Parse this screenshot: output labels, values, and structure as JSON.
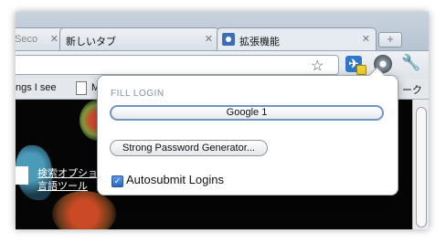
{
  "tabs": [
    {
      "label": "Seco",
      "close": "✕"
    },
    {
      "label": "新しいタブ",
      "close": "✕"
    },
    {
      "label": "拡張機能",
      "close": "✕"
    }
  ],
  "new_tab_label": "+",
  "toolbar": {
    "star": "☆",
    "ext_icon_glyph": "✈",
    "wrench": "🔧"
  },
  "bookmarks": {
    "item1": "ngs I see",
    "item2": "M",
    "item3": "ーク"
  },
  "page": {
    "link1": "検索オプション",
    "link2": "言語ツール",
    "corner": "_"
  },
  "popup": {
    "section_title": "FILL LOGIN",
    "login_button": "Google 1",
    "generator_button": "Strong Password Generator...",
    "autosubmit_label": "Autosubmit Logins",
    "autosubmit_checked": "✓"
  },
  "colors": {
    "accent": "#7393c4",
    "checkbox": "#2c67c2"
  }
}
